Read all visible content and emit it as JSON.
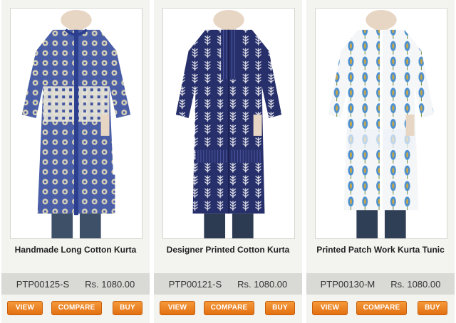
{
  "products": [
    {
      "title": "Handmade Long Cotton Kurta",
      "sku": "PTP00125-S",
      "price": "Rs. 1080.00",
      "view_label": "VIEW",
      "compare_label": "COMPARE",
      "buy_label": "BUY"
    },
    {
      "title": "Designer Printed Cotton Kurta",
      "sku": "PTP00121-S",
      "price": "Rs. 1080.00",
      "view_label": "VIEW",
      "compare_label": "COMPARE",
      "buy_label": "BUY"
    },
    {
      "title": "Printed Patch Work Kurta Tunic",
      "sku": "PTP00130-M",
      "price": "Rs. 1080.00",
      "view_label": "VIEW",
      "compare_label": "COMPARE",
      "buy_label": "BUY"
    }
  ],
  "colors": {
    "button": "#e8801f",
    "price_bar": "#d9d9d6",
    "card_bg": "#f3f3f0"
  }
}
